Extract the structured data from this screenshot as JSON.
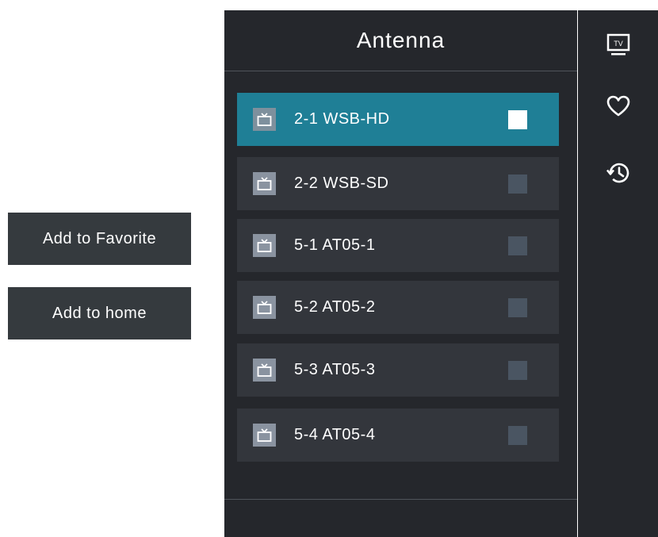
{
  "left_actions": {
    "add_favorite": "Add to Favorite",
    "add_home": "Add to home"
  },
  "panel": {
    "title": "Antenna",
    "channels": [
      {
        "name": "2-1 WSB-HD",
        "selected": true
      },
      {
        "name": "2-2 WSB-SD",
        "selected": false
      },
      {
        "name": "5-1 AT05-1",
        "selected": false
      },
      {
        "name": "5-2 AT05-2",
        "selected": false
      },
      {
        "name": "5-3 AT05-3",
        "selected": false
      },
      {
        "name": "5-4 AT05-4",
        "selected": false
      }
    ]
  },
  "rail": {
    "tv_icon_label": "TV",
    "icons": [
      "tv-icon",
      "heart-icon",
      "history-icon"
    ]
  },
  "colors": {
    "panel_bg": "#25272c",
    "row_bg": "#33363c",
    "selected_row_bg": "#1f7f96",
    "button_bg": "#353a3e"
  }
}
